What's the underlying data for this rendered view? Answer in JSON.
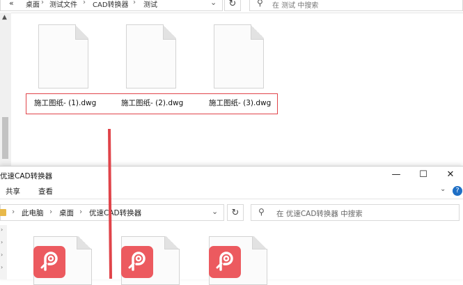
{
  "top_window": {
    "breadcrumb": [
      "桌面",
      "测试文件",
      "CAD转换器",
      "测试"
    ],
    "search_placeholder": "在 测试 中搜索",
    "files": [
      {
        "name": "施工图纸- (1).dwg"
      },
      {
        "name": "施工图纸- (2).dwg"
      },
      {
        "name": "施工图纸- (3).dwg"
      }
    ]
  },
  "front_window": {
    "title": "优速CAD转换器",
    "controls": {
      "minimize": "—",
      "maximize": "☐",
      "close": "✕"
    },
    "ribbon_tabs": [
      "共享",
      "查看"
    ],
    "help": "?",
    "path": [
      "此电脑",
      "桌面",
      "优速CAD转换器"
    ],
    "search_placeholder": "在 优速CAD转换器 中搜索"
  },
  "colors": {
    "highlight_border": "#e0444a",
    "arrow": "#e0444a",
    "app_icon": "#ec5a5f"
  }
}
